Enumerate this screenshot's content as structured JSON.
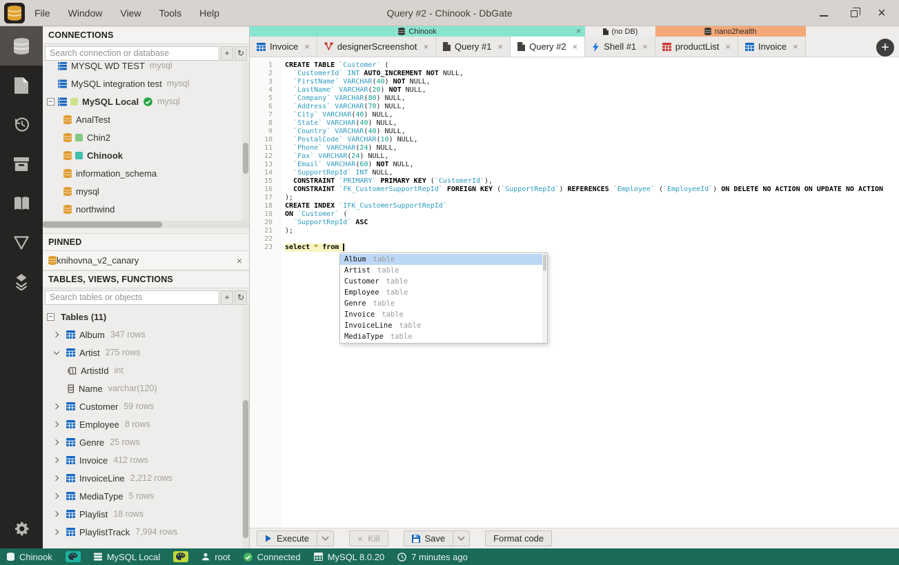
{
  "window": {
    "title": "Query #2 - Chinook - DbGate",
    "menus": [
      "File",
      "Window",
      "View",
      "Tools",
      "Help"
    ]
  },
  "rail": {
    "items": [
      "database",
      "file",
      "history",
      "archive",
      "book",
      "funnel",
      "layers"
    ],
    "active_index": 0,
    "bottom": "gear"
  },
  "connections": {
    "header": "CONNECTIONS",
    "search_placeholder": "Search connection or database",
    "add_label": "+",
    "refresh_label": "↻",
    "items": [
      {
        "label": "MYSQL WD TEST",
        "suffix": "mysql",
        "icon": "server",
        "level": 0
      },
      {
        "label": "MySQL integration test",
        "suffix": "mysql",
        "icon": "server",
        "level": 0
      },
      {
        "label": "MySQL Local",
        "suffix": "mysql",
        "icon": "server",
        "level": 0,
        "expanded": true,
        "bold": true,
        "color": "#cde388",
        "check": true
      },
      {
        "label": "AnalTest",
        "icon": "db",
        "level": 1
      },
      {
        "label": "Chin2",
        "icon": "db",
        "level": 1,
        "color": "#84c883"
      },
      {
        "label": "Chinook",
        "icon": "db",
        "level": 1,
        "color": "#3fbfae",
        "bold": true
      },
      {
        "label": "information_schema",
        "icon": "db",
        "level": 1
      },
      {
        "label": "mysql",
        "icon": "db",
        "level": 1
      },
      {
        "label": "northwind",
        "icon": "db",
        "level": 1
      },
      {
        "label": "",
        "icon": "db",
        "level": 1
      }
    ]
  },
  "pinned": {
    "header": "PINNED",
    "items": [
      {
        "label": "knihovna_v2_canary",
        "icon": "db",
        "close": "×"
      }
    ]
  },
  "tables_panel": {
    "header": "TABLES, VIEWS, FUNCTIONS",
    "search_placeholder": "Search tables or objects",
    "add_label": "+",
    "refresh_label": "↻",
    "group_label": "Tables (11)",
    "items": [
      {
        "label": "Album",
        "meta": "347 rows",
        "kind": "table",
        "state": "collapsed"
      },
      {
        "label": "Artist",
        "meta": "275 rows",
        "kind": "table",
        "state": "expanded"
      },
      {
        "label": "ArtistId",
        "meta": "int",
        "kind": "pk-column"
      },
      {
        "label": "Name",
        "meta": "varchar(120)",
        "kind": "column"
      },
      {
        "label": "Customer",
        "meta": "59 rows",
        "kind": "table",
        "state": "collapsed"
      },
      {
        "label": "Employee",
        "meta": "8 rows",
        "kind": "table",
        "state": "collapsed"
      },
      {
        "label": "Genre",
        "meta": "25 rows",
        "kind": "table",
        "state": "collapsed"
      },
      {
        "label": "Invoice",
        "meta": "412 rows",
        "kind": "table",
        "state": "collapsed"
      },
      {
        "label": "InvoiceLine",
        "meta": "2,212 rows",
        "kind": "table",
        "state": "collapsed"
      },
      {
        "label": "MediaType",
        "meta": "5 rows",
        "kind": "table",
        "state": "collapsed"
      },
      {
        "label": "Playlist",
        "meta": "18 rows",
        "kind": "table",
        "state": "collapsed"
      },
      {
        "label": "PlaylistTrack",
        "meta": "7,994 rows",
        "kind": "table",
        "state": "collapsed"
      }
    ]
  },
  "tabstrip": {
    "add_button": "+",
    "groups": [
      {
        "label": "Chinook",
        "color": "#87e4cf",
        "icon": "database",
        "closable": true,
        "close_label": "×",
        "tabs": [
          {
            "label": "Invoice",
            "icon": "table-blue",
            "close": "×"
          },
          {
            "label": "designerScreenshot",
            "icon": "designer-red",
            "close": "×"
          },
          {
            "label": "Query #1",
            "icon": "file",
            "close": "×"
          },
          {
            "label": "Query #2",
            "icon": "file",
            "close": "×",
            "active": true
          }
        ]
      },
      {
        "label": "(no DB)",
        "color": "#efedeb",
        "icon": "file",
        "tabs": [
          {
            "label": "Shell #1",
            "icon": "bolt-blue",
            "close": "×"
          }
        ]
      },
      {
        "label": "nano2health",
        "color": "#f4a777",
        "icon": "database",
        "tabs": [
          {
            "label": "productList",
            "icon": "table-red",
            "close": "×"
          },
          {
            "label": "Invoice",
            "icon": "table-blue",
            "close": "×"
          }
        ]
      }
    ]
  },
  "editor": {
    "current_line": 23,
    "lines": [
      [
        [
          "k",
          "CREATE TABLE"
        ],
        [
          "p",
          " "
        ],
        [
          "i",
          "`Customer`"
        ],
        [
          "p",
          " ("
        ]
      ],
      [
        [
          "p",
          "  "
        ],
        [
          "i",
          "`CustomerId`"
        ],
        [
          "p",
          " "
        ],
        [
          "i",
          "INT"
        ],
        [
          "p",
          " "
        ],
        [
          "k",
          "AUTO_INCREMENT"
        ],
        [
          "p",
          " "
        ],
        [
          "k",
          "NOT"
        ],
        [
          "p",
          " NULL,"
        ]
      ],
      [
        [
          "p",
          "  "
        ],
        [
          "i",
          "`FirstName`"
        ],
        [
          "p",
          " "
        ],
        [
          "i",
          "VARCHAR"
        ],
        [
          "p",
          "("
        ],
        [
          "n",
          "40"
        ],
        [
          "p",
          ") "
        ],
        [
          "k",
          "NOT"
        ],
        [
          "p",
          " NULL,"
        ]
      ],
      [
        [
          "p",
          "  "
        ],
        [
          "i",
          "`LastName`"
        ],
        [
          "p",
          " "
        ],
        [
          "i",
          "VARCHAR"
        ],
        [
          "p",
          "("
        ],
        [
          "n",
          "20"
        ],
        [
          "p",
          ") "
        ],
        [
          "k",
          "NOT"
        ],
        [
          "p",
          " NULL,"
        ]
      ],
      [
        [
          "p",
          "  "
        ],
        [
          "i",
          "`Company`"
        ],
        [
          "p",
          " "
        ],
        [
          "i",
          "VARCHAR"
        ],
        [
          "p",
          "("
        ],
        [
          "n",
          "80"
        ],
        [
          "p",
          ") NULL,"
        ]
      ],
      [
        [
          "p",
          "  "
        ],
        [
          "i",
          "`Address`"
        ],
        [
          "p",
          " "
        ],
        [
          "i",
          "VARCHAR"
        ],
        [
          "p",
          "("
        ],
        [
          "n",
          "70"
        ],
        [
          "p",
          ") NULL,"
        ]
      ],
      [
        [
          "p",
          "  "
        ],
        [
          "i",
          "`City`"
        ],
        [
          "p",
          " "
        ],
        [
          "i",
          "VARCHAR"
        ],
        [
          "p",
          "("
        ],
        [
          "n",
          "40"
        ],
        [
          "p",
          ") NULL,"
        ]
      ],
      [
        [
          "p",
          "  "
        ],
        [
          "i",
          "`State`"
        ],
        [
          "p",
          " "
        ],
        [
          "i",
          "VARCHAR"
        ],
        [
          "p",
          "("
        ],
        [
          "n",
          "40"
        ],
        [
          "p",
          ") NULL,"
        ]
      ],
      [
        [
          "p",
          "  "
        ],
        [
          "i",
          "`Country`"
        ],
        [
          "p",
          " "
        ],
        [
          "i",
          "VARCHAR"
        ],
        [
          "p",
          "("
        ],
        [
          "n",
          "40"
        ],
        [
          "p",
          ") NULL,"
        ]
      ],
      [
        [
          "p",
          "  "
        ],
        [
          "i",
          "`PostalCode`"
        ],
        [
          "p",
          " "
        ],
        [
          "i",
          "VARCHAR"
        ],
        [
          "p",
          "("
        ],
        [
          "n",
          "10"
        ],
        [
          "p",
          ") NULL,"
        ]
      ],
      [
        [
          "p",
          "  "
        ],
        [
          "i",
          "`Phone`"
        ],
        [
          "p",
          " "
        ],
        [
          "i",
          "VARCHAR"
        ],
        [
          "p",
          "("
        ],
        [
          "n",
          "24"
        ],
        [
          "p",
          ") NULL,"
        ]
      ],
      [
        [
          "p",
          "  "
        ],
        [
          "i",
          "`Fax`"
        ],
        [
          "p",
          " "
        ],
        [
          "i",
          "VARCHAR"
        ],
        [
          "p",
          "("
        ],
        [
          "n",
          "24"
        ],
        [
          "p",
          ") NULL,"
        ]
      ],
      [
        [
          "p",
          "  "
        ],
        [
          "i",
          "`Email`"
        ],
        [
          "p",
          " "
        ],
        [
          "i",
          "VARCHAR"
        ],
        [
          "p",
          "("
        ],
        [
          "n",
          "60"
        ],
        [
          "p",
          ") "
        ],
        [
          "k",
          "NOT"
        ],
        [
          "p",
          " NULL,"
        ]
      ],
      [
        [
          "p",
          "  "
        ],
        [
          "i",
          "`SupportRepId`"
        ],
        [
          "p",
          " "
        ],
        [
          "i",
          "INT"
        ],
        [
          "p",
          " NULL,"
        ]
      ],
      [
        [
          "p",
          "  "
        ],
        [
          "k",
          "CONSTRAINT"
        ],
        [
          "p",
          " "
        ],
        [
          "i",
          "`PRIMARY`"
        ],
        [
          "p",
          " "
        ],
        [
          "k",
          "PRIMARY KEY"
        ],
        [
          "p",
          " ("
        ],
        [
          "i",
          "`CustomerId`"
        ],
        [
          "p",
          "),"
        ]
      ],
      [
        [
          "p",
          "  "
        ],
        [
          "k",
          "CONSTRAINT"
        ],
        [
          "p",
          " "
        ],
        [
          "i",
          "`FK_CustomerSupportRepId`"
        ],
        [
          "p",
          " "
        ],
        [
          "k",
          "FOREIGN KEY"
        ],
        [
          "p",
          " ("
        ],
        [
          "i",
          "`SupportRepId`"
        ],
        [
          "p",
          ") "
        ],
        [
          "k",
          "REFERENCES"
        ],
        [
          "p",
          " "
        ],
        [
          "i",
          "`Employee`"
        ],
        [
          "p",
          " ("
        ],
        [
          "i",
          "`EmployeeId`"
        ],
        [
          "p",
          ") "
        ],
        [
          "k",
          "ON DELETE NO ACTION ON UPDATE NO ACTION"
        ]
      ],
      [
        [
          "p",
          ");"
        ]
      ],
      [
        [
          "k",
          "CREATE INDEX"
        ],
        [
          "p",
          " "
        ],
        [
          "i",
          "`IFK_CustomerSupportRepId`"
        ]
      ],
      [
        [
          "k",
          "ON"
        ],
        [
          "p",
          " "
        ],
        [
          "i",
          "`Customer`"
        ],
        [
          "p",
          " ("
        ]
      ],
      [
        [
          "p",
          "  "
        ],
        [
          "i",
          "`SupportRepId`"
        ],
        [
          "p",
          " "
        ],
        [
          "k",
          "ASC"
        ]
      ],
      [
        [
          "p",
          ");"
        ]
      ],
      [],
      [
        [
          "k",
          "select"
        ],
        [
          "p",
          " "
        ],
        [
          "s",
          "*"
        ],
        [
          "p",
          " "
        ],
        [
          "k",
          "from"
        ],
        [
          "p",
          " "
        ]
      ]
    ],
    "autocomplete": {
      "items": [
        {
          "name": "Album",
          "kind": "table",
          "selected": true
        },
        {
          "name": "Artist",
          "kind": "table"
        },
        {
          "name": "Customer",
          "kind": "table"
        },
        {
          "name": "Employee",
          "kind": "table"
        },
        {
          "name": "Genre",
          "kind": "table"
        },
        {
          "name": "Invoice",
          "kind": "table"
        },
        {
          "name": "InvoiceLine",
          "kind": "table"
        },
        {
          "name": "MediaType",
          "kind": "table"
        }
      ]
    }
  },
  "toolbar": {
    "execute_label": "Execute",
    "kill_label": "Kill",
    "save_label": "Save",
    "format_label": "Format code"
  },
  "statusbar": {
    "items": [
      {
        "icon": "database",
        "label": "Chinook"
      },
      {
        "icon": "palette",
        "chip_color": "#1db5a2"
      },
      {
        "icon": "server",
        "label": "MySQL Local"
      },
      {
        "icon": "palette",
        "chip_color": "#c3da3d"
      },
      {
        "icon": "person",
        "label": "root"
      },
      {
        "icon": "check",
        "label": "Connected"
      },
      {
        "icon": "grid",
        "label": "MySQL 8.0.20"
      },
      {
        "icon": "clock",
        "label": "7 minutes ago"
      }
    ],
    "background": "#1a6b59"
  },
  "colors": {
    "accent_cyan": "#2e9bbf",
    "accent_teal_group": "#87e4cf",
    "accent_orange_group": "#f4a777",
    "statusbar_bg": "#1a6b59"
  }
}
